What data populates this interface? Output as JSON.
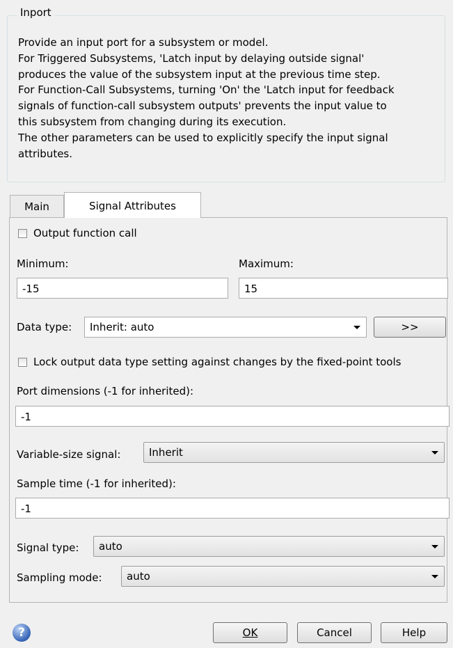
{
  "group": {
    "title": "Inport",
    "description": [
      "Provide an input port for a subsystem or model.",
      "For Triggered Subsystems, 'Latch input by delaying outside signal'",
      "produces the value of the subsystem input at the previous time step.",
      "For Function-Call Subsystems, turning 'On' the 'Latch input for feedback",
      "signals of function-call subsystem outputs' prevents the input value to",
      "this subsystem from changing during its execution.",
      "The other parameters can be used to explicitly specify the input signal",
      "attributes."
    ]
  },
  "tabs": [
    {
      "label": "Main",
      "active": false
    },
    {
      "label": "Signal Attributes",
      "active": true
    }
  ],
  "form": {
    "output_function_call": {
      "label": "Output function call",
      "checked": false
    },
    "minimum": {
      "label": "Minimum:",
      "value": "-15"
    },
    "maximum": {
      "label": "Maximum:",
      "value": "15"
    },
    "data_type": {
      "label": "Data type:",
      "value": "Inherit: auto",
      "button": ">>"
    },
    "lock_output": {
      "label": "Lock output data type setting against changes by the fixed-point tools",
      "checked": false
    },
    "port_dimensions": {
      "label": "Port dimensions (-1 for inherited):",
      "value": "-1"
    },
    "variable_size": {
      "label": "Variable-size signal:",
      "value": "Inherit"
    },
    "sample_time": {
      "label": "Sample time (-1 for inherited):",
      "value": "-1"
    },
    "signal_type": {
      "label": "Signal type:",
      "value": "auto"
    },
    "sampling_mode": {
      "label": "Sampling mode:",
      "value": "auto"
    }
  },
  "buttons": {
    "ok": "OK",
    "cancel": "Cancel",
    "help": "Help"
  },
  "icons": {
    "help": "help-circle-icon"
  }
}
